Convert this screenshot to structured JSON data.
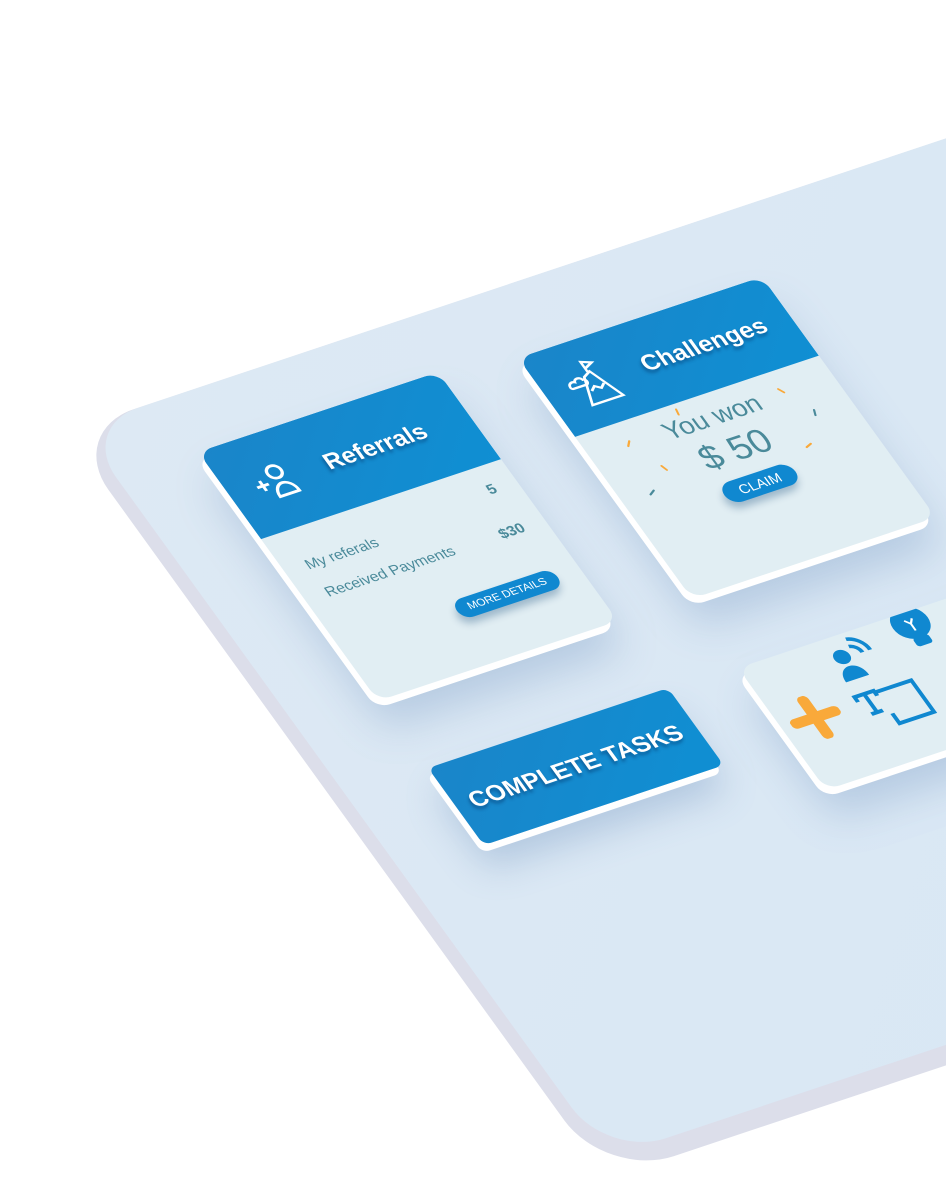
{
  "referrals": {
    "title": "Referrals",
    "icon": "add-user-icon",
    "rows": [
      {
        "label": "My referals",
        "value": "5"
      },
      {
        "label": "Received Payments",
        "value": "$30"
      }
    ],
    "button": "MORE DETAILS"
  },
  "challenges": {
    "title": "Challenges",
    "icon": "mountain-flag-icon",
    "message": "You won",
    "amount": "$ 50",
    "button": "CLAIM"
  },
  "tasks": {
    "button": "COMPLETE TASKS"
  },
  "tools": {
    "icons": [
      "plus-icon",
      "broadcast-user-icon",
      "lightbulb-icon",
      "text-box-icon"
    ]
  },
  "colors": {
    "primary": "#1088d0",
    "accent": "#f9a93a",
    "text": "#4a8a9a",
    "card": "#e1eef3"
  }
}
